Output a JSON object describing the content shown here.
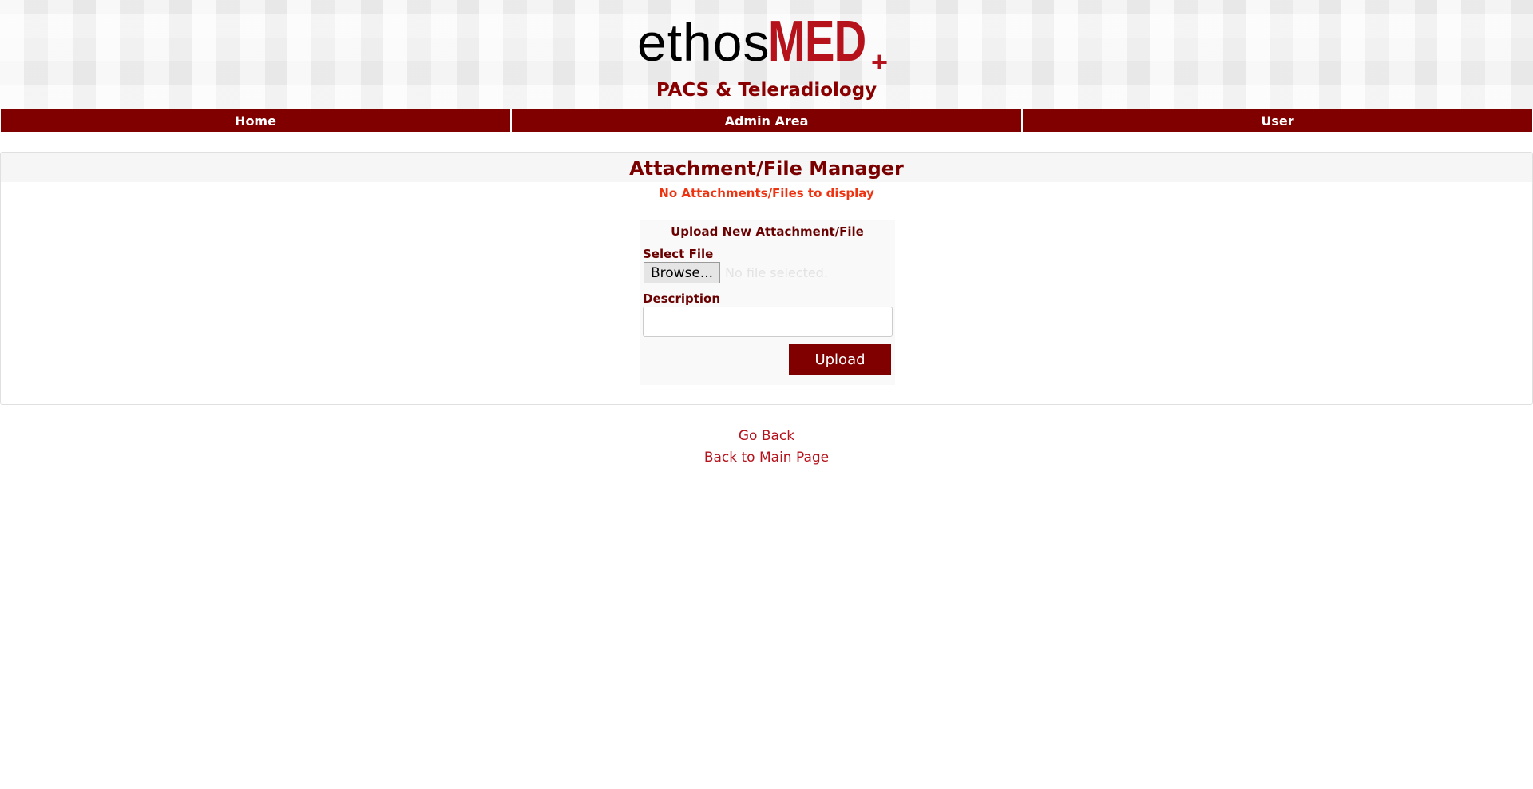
{
  "brand": {
    "logo_part1": "ethos",
    "logo_part2": "MED",
    "logo_part3": "+",
    "subtitle": "PACS & Teleradiology",
    "colors": {
      "accent": "#800000",
      "logo_red": "#b5121b",
      "error": "#ee3311"
    }
  },
  "nav": {
    "items": [
      {
        "label": "Home"
      },
      {
        "label": "Admin Area"
      },
      {
        "label": "User"
      }
    ]
  },
  "main": {
    "title": "Attachment/File Manager",
    "empty_message": "No Attachments/Files to display",
    "upload": {
      "title": "Upload New Attachment/File",
      "select_file_label": "Select File",
      "browse_label": "Browse...",
      "no_file_text": "No file selected.",
      "description_label": "Description",
      "description_value": "",
      "upload_label": "Upload"
    }
  },
  "links": {
    "go_back": "Go Back",
    "main_page": "Back to Main Page"
  }
}
